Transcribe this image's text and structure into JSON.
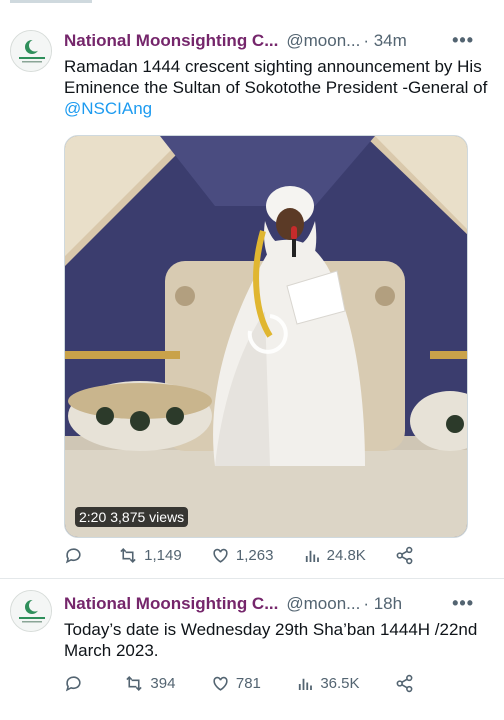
{
  "tweets": [
    {
      "author_name": "National Moonsighting C...",
      "handle": "@moon...",
      "time": "· 34m",
      "more": "•••",
      "text_main": "Ramadan 1444 crescent sighting announcement by His Eminence the Sultan of Sokotothe President -General of ",
      "mention": "@NSCIAng",
      "video": {
        "duration": "2:20",
        "views": "3,875 views"
      },
      "stats": {
        "replies": "",
        "retweets": "1,149",
        "likes": "1,263",
        "views": "24.8K"
      }
    },
    {
      "author_name": "National Moonsighting C...",
      "handle": "@moon...",
      "time": "· 18h",
      "more": "•••",
      "text_main": "Today’s date is Wednesday 29th Sha’ban 1444H /22nd  March 2023.",
      "stats": {
        "replies": "",
        "retweets": "394",
        "likes": "781",
        "views": "36.5K"
      }
    }
  ],
  "colors": {
    "name": "#75266b",
    "mention": "#1d9bf0",
    "muted": "#536471"
  },
  "icons": [
    "reply-icon",
    "retweet-icon",
    "like-icon",
    "views-icon",
    "share-icon",
    "more-icon",
    "crescent-logo-icon"
  ]
}
